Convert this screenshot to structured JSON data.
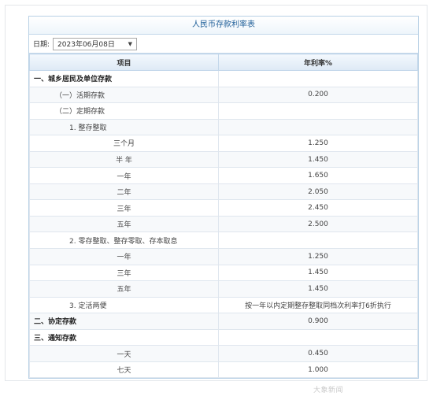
{
  "title": "人民币存款利率表",
  "date": {
    "label": "日期:",
    "value": "2023年06月08日"
  },
  "table": {
    "headers": [
      "项目",
      "年利率%"
    ],
    "rows": [
      {
        "item": "一、城乡居民及单位存款",
        "rate": "",
        "level": 1
      },
      {
        "item": "（一）活期存款",
        "rate": "0.200",
        "level": 2
      },
      {
        "item": "（二）定期存款",
        "rate": "",
        "level": 2
      },
      {
        "item": "1. 整存整取",
        "rate": "",
        "level": 3
      },
      {
        "item": "三个月",
        "rate": "1.250",
        "level": 4
      },
      {
        "item": "半 年",
        "rate": "1.450",
        "level": 4
      },
      {
        "item": "一年",
        "rate": "1.650",
        "level": 4
      },
      {
        "item": "二年",
        "rate": "2.050",
        "level": 4
      },
      {
        "item": "三年",
        "rate": "2.450",
        "level": 4
      },
      {
        "item": "五年",
        "rate": "2.500",
        "level": 4
      },
      {
        "item": "2. 零存整取、整存零取、存本取息",
        "rate": "",
        "level": 3
      },
      {
        "item": "一年",
        "rate": "1.250",
        "level": 4
      },
      {
        "item": "三年",
        "rate": "1.450",
        "level": 4
      },
      {
        "item": "五年",
        "rate": "1.450",
        "level": 4
      },
      {
        "item": "3. 定活两便",
        "rate": "按一年以内定期整存整取同档次利率打6折执行",
        "level": 3
      },
      {
        "item": "二、协定存款",
        "rate": "0.900",
        "level": 1
      },
      {
        "item": "三、通知存款",
        "rate": "",
        "level": 1
      },
      {
        "item": "一天",
        "rate": "0.450",
        "level": 4
      },
      {
        "item": "七天",
        "rate": "1.000",
        "level": 4
      }
    ]
  },
  "watermark": "大象新闻"
}
